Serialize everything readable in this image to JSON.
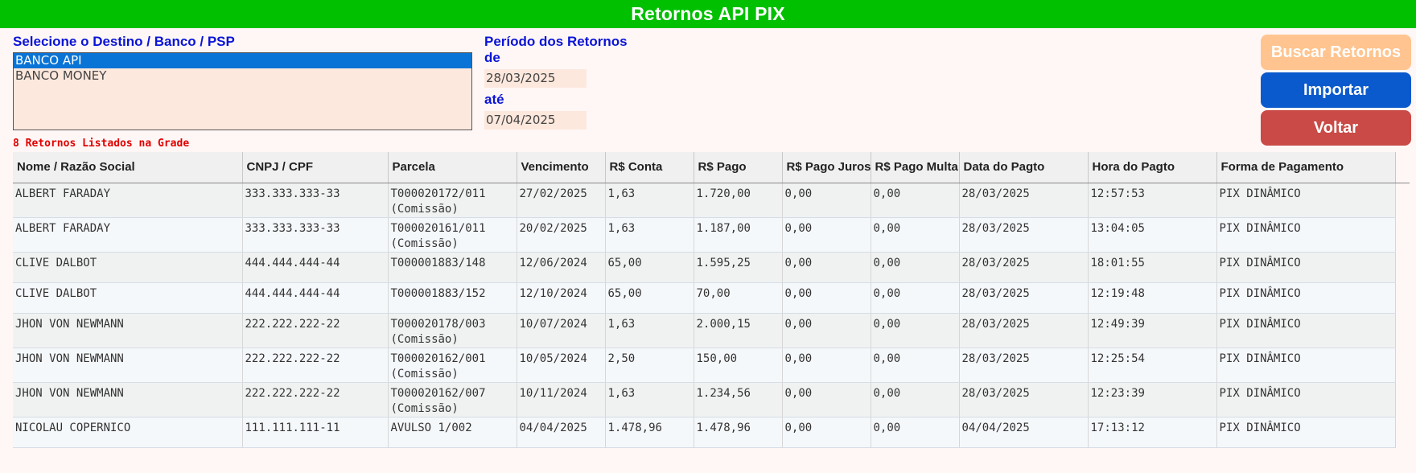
{
  "app": {
    "title": "Retornos API PIX"
  },
  "destino": {
    "label": "Selecione o Destino / Banco / PSP",
    "options": [
      "BANCO API",
      "BANCO MONEY"
    ],
    "selected": "BANCO API"
  },
  "periodo": {
    "label": "Período dos Retornos",
    "de_label": "de",
    "de_value": "28/03/2025",
    "ate_label": "até",
    "ate_value": "07/04/2025"
  },
  "buttons": {
    "buscar": "Buscar Retornos",
    "importar": "Importar",
    "voltar": "Voltar"
  },
  "colors": {
    "titlebar": "#00c000",
    "label_blue": "#0a14d6",
    "count_red": "#e00000",
    "btn_buscar": "#ffc48f",
    "btn_importar": "#0a5acd",
    "btn_voltar": "#c94a46",
    "input_bg": "#fde8dd"
  },
  "count_text": "8 Retornos Listados na Grade",
  "grid": {
    "columns": [
      "Nome / Razão Social",
      "CNPJ / CPF",
      "Parcela",
      "Vencimento",
      "R$ Conta",
      "R$ Pago",
      "R$ Pago Juros",
      "R$ Pago Multa",
      "Data do Pagto",
      "Hora do Pagto",
      "Forma de Pagamento"
    ],
    "rows": [
      [
        "ALBERT FARADAY",
        "333.333.333-33",
        "T000020172/011\n(Comissão)",
        "27/02/2025",
        "1,63",
        "1.720,00",
        "0,00",
        "0,00",
        "28/03/2025",
        "12:57:53",
        "PIX DINÂMICO"
      ],
      [
        "ALBERT FARADAY",
        "333.333.333-33",
        "T000020161/011\n(Comissão)",
        "20/02/2025",
        "1,63",
        "1.187,00",
        "0,00",
        "0,00",
        "28/03/2025",
        "13:04:05",
        "PIX DINÂMICO"
      ],
      [
        "CLIVE DALBOT",
        "444.444.444-44",
        "T000001883/148",
        "12/06/2024",
        "65,00",
        "1.595,25",
        "0,00",
        "0,00",
        "28/03/2025",
        "18:01:55",
        "PIX DINÂMICO"
      ],
      [
        "CLIVE DALBOT",
        "444.444.444-44",
        "T000001883/152",
        "12/10/2024",
        "65,00",
        "70,00",
        "0,00",
        "0,00",
        "28/03/2025",
        "12:19:48",
        "PIX DINÂMICO"
      ],
      [
        "JHON VON NEWMANN",
        "222.222.222-22",
        "T000020178/003\n(Comissão)",
        "10/07/2024",
        "1,63",
        "2.000,15",
        "0,00",
        "0,00",
        "28/03/2025",
        "12:49:39",
        "PIX DINÂMICO"
      ],
      [
        "JHON VON NEWMANN",
        "222.222.222-22",
        "T000020162/001\n(Comissão)",
        "10/05/2024",
        "2,50",
        "150,00",
        "0,00",
        "0,00",
        "28/03/2025",
        "12:25:54",
        "PIX DINÂMICO"
      ],
      [
        "JHON VON NEWMANN",
        "222.222.222-22",
        "T000020162/007\n(Comissão)",
        "10/11/2024",
        "1,63",
        "1.234,56",
        "0,00",
        "0,00",
        "28/03/2025",
        "12:23:39",
        "PIX DINÂMICO"
      ],
      [
        "NICOLAU COPERNICO",
        "111.111.111-11",
        "AVULSO 1/002",
        "04/04/2025",
        "1.478,96",
        "1.478,96",
        "0,00",
        "0,00",
        "04/04/2025",
        "17:13:12",
        "PIX DINÂMICO"
      ]
    ]
  }
}
